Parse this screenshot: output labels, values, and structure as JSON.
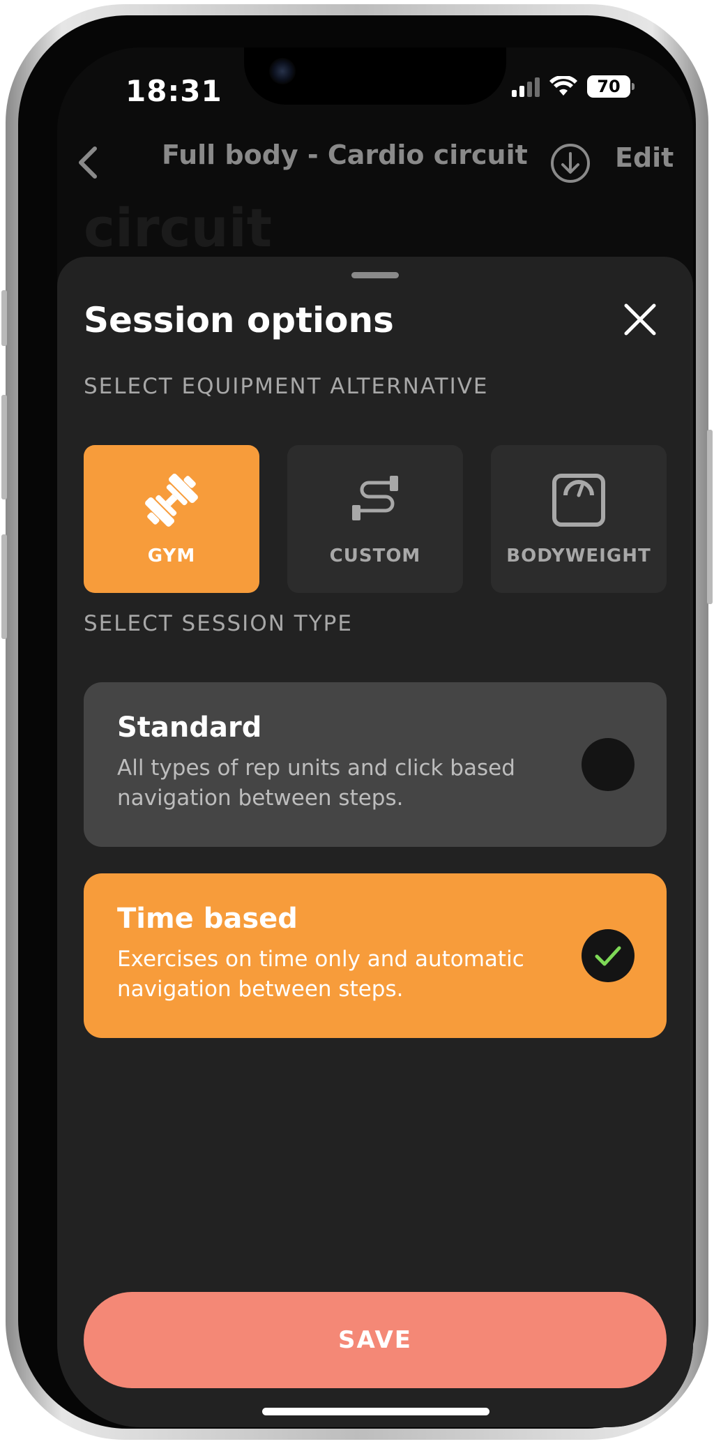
{
  "status_bar": {
    "time": "18:31",
    "battery": "70"
  },
  "nav": {
    "title": "Full body - Cardio circuit",
    "edit_label": "Edit"
  },
  "background_heading": "circuit",
  "sheet": {
    "title": "Session options",
    "equipment_section_label": "SELECT EQUIPMENT ALTERNATIVE",
    "equipment_options": [
      {
        "label": "GYM",
        "icon": "dumbbell-icon",
        "selected": true
      },
      {
        "label": "CUSTOM",
        "icon": "resistance-band-icon",
        "selected": false
      },
      {
        "label": "BODYWEIGHT",
        "icon": "scale-icon",
        "selected": false
      }
    ],
    "session_section_label": "SELECT SESSION TYPE",
    "session_types": [
      {
        "title": "Standard",
        "description": "All types of rep units and click based navigation between steps.",
        "selected": false
      },
      {
        "title": "Time based",
        "description": "Exercises on time only and automatic navigation between steps.",
        "selected": true
      }
    ],
    "save_label": "SAVE"
  },
  "colors": {
    "accent": "#f79c3b",
    "save_button": "#f48876",
    "sheet_background": "#222222",
    "check": "#7ed957"
  }
}
